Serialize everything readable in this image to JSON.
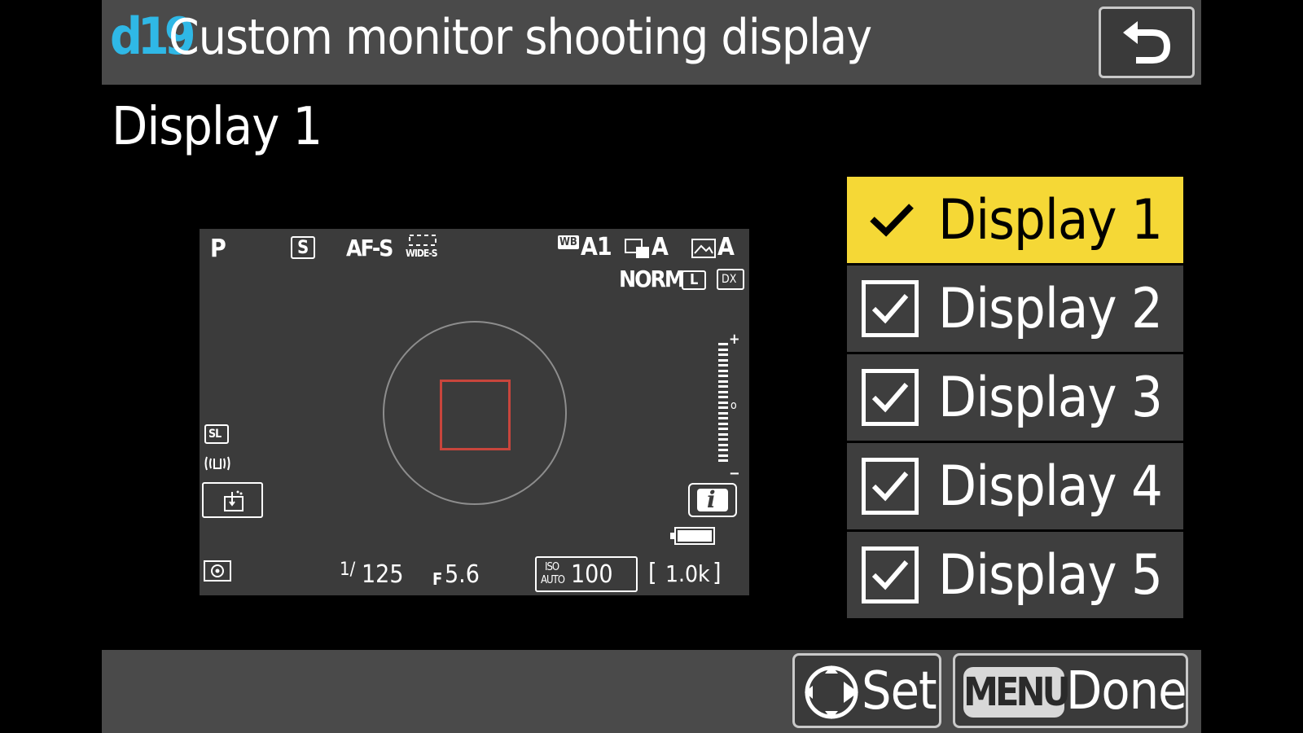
{
  "header": {
    "menu_code": "d19",
    "title": "Custom monitor shooting display"
  },
  "subtitle": "Display 1",
  "preview": {
    "mode": "P",
    "release_mode": "S",
    "af_mode": "AF-S",
    "af_area": "WIDE-S",
    "wb_badge": "WB",
    "wb_value": "A1",
    "picture_control": "A",
    "active_d_lighting": "A",
    "image_quality": "NORM",
    "image_size": "L",
    "image_area": "DX",
    "vr_badge": "SL",
    "shutter_prefix": "1/",
    "shutter_value": "125",
    "aperture_prefix": "F",
    "aperture_value": "5.6",
    "iso_top": "ISO",
    "iso_bottom": "AUTO",
    "iso_value": "100",
    "shots_remaining": "1.0k",
    "info_label": "i"
  },
  "list": {
    "items": [
      {
        "label": "Display 1",
        "selected": true
      },
      {
        "label": "Display 2",
        "selected": false
      },
      {
        "label": "Display 3",
        "selected": false
      },
      {
        "label": "Display 4",
        "selected": false
      },
      {
        "label": "Display 5",
        "selected": false
      }
    ]
  },
  "footer": {
    "set_label": "Set",
    "menu_badge": "MENU",
    "done_label": "Done"
  },
  "colors": {
    "accent_yellow": "#f5d836",
    "menu_code_blue": "#2fb8e6",
    "af_frame_red": "#c8453c",
    "bar_gray": "#4a4a4a"
  },
  "icons": [
    "back-arrow-icon",
    "checkmark-icon",
    "checkbox-icon",
    "multi-selector-icon",
    "metering-icon",
    "vibration-reduction-icon",
    "touch-shutter-icon",
    "battery-icon"
  ]
}
